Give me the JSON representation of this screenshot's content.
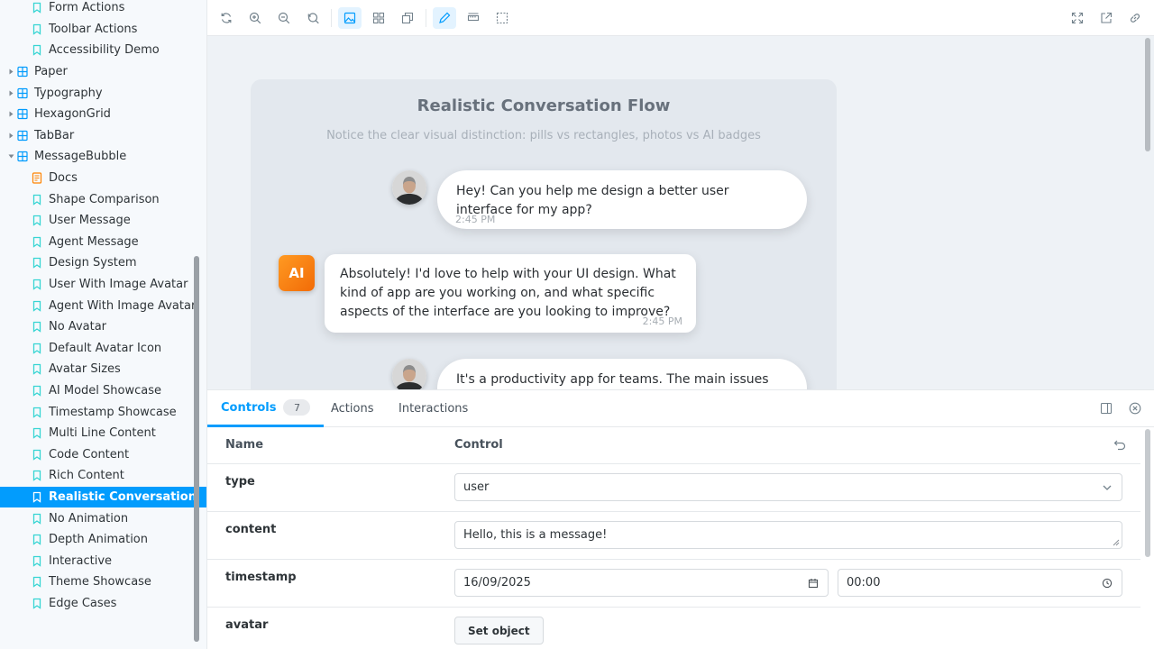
{
  "sidebar": {
    "items": [
      {
        "label": "Form Actions",
        "kind": "story"
      },
      {
        "label": "Toolbar Actions",
        "kind": "story"
      },
      {
        "label": "Accessibility Demo",
        "kind": "story"
      },
      {
        "label": "Paper",
        "kind": "component"
      },
      {
        "label": "Typography",
        "kind": "component"
      },
      {
        "label": "HexagonGrid",
        "kind": "component"
      },
      {
        "label": "TabBar",
        "kind": "component"
      },
      {
        "label": "MessageBubble",
        "kind": "component-open"
      },
      {
        "label": "Docs",
        "kind": "docs"
      },
      {
        "label": "Shape Comparison",
        "kind": "story"
      },
      {
        "label": "User Message",
        "kind": "story"
      },
      {
        "label": "Agent Message",
        "kind": "story"
      },
      {
        "label": "Design System",
        "kind": "story"
      },
      {
        "label": "User With Image Avatar",
        "kind": "story"
      },
      {
        "label": "Agent With Image Avatar",
        "kind": "story"
      },
      {
        "label": "No Avatar",
        "kind": "story"
      },
      {
        "label": "Default Avatar Icon",
        "kind": "story"
      },
      {
        "label": "Avatar Sizes",
        "kind": "story"
      },
      {
        "label": "AI Model Showcase",
        "kind": "story"
      },
      {
        "label": "Timestamp Showcase",
        "kind": "story"
      },
      {
        "label": "Multi Line Content",
        "kind": "story"
      },
      {
        "label": "Code Content",
        "kind": "story"
      },
      {
        "label": "Rich Content",
        "kind": "story"
      },
      {
        "label": "Realistic Conversation",
        "kind": "story",
        "active": true
      },
      {
        "label": "No Animation",
        "kind": "story"
      },
      {
        "label": "Depth Animation",
        "kind": "story"
      },
      {
        "label": "Interactive",
        "kind": "story"
      },
      {
        "label": "Theme Showcase",
        "kind": "story"
      },
      {
        "label": "Edge Cases",
        "kind": "story"
      }
    ]
  },
  "colors": {
    "accent": "#029cfd",
    "story_icon": "#37d5d3",
    "component_icon": "#029cfd",
    "docs_icon": "#ff8300"
  },
  "preview": {
    "title": "Realistic Conversation Flow",
    "subtitle": "Notice the clear visual distinction: pills vs rectangles, photos vs AI badges",
    "messages": [
      {
        "type": "user",
        "text": "Hey! Can you help me design a better user interface for my app?",
        "timestamp": "2:45 PM"
      },
      {
        "type": "agent",
        "badge": "AI",
        "text": "Absolutely! I'd love to help with your UI design. What kind of app are you working on, and what specific aspects of the interface are you looking to improve?",
        "timestamp": "2:45 PM"
      },
      {
        "type": "user",
        "text": "It's a productivity app for teams. The main issues"
      }
    ]
  },
  "panel": {
    "tabs": [
      {
        "label": "Controls",
        "count": "7"
      },
      {
        "label": "Actions"
      },
      {
        "label": "Interactions"
      }
    ],
    "header": {
      "name": "Name",
      "control": "Control"
    },
    "rows": {
      "type": {
        "name": "type",
        "value": "user"
      },
      "content": {
        "name": "content",
        "value": "Hello, this is a message!"
      },
      "timestamp": {
        "name": "timestamp",
        "date": "16/09/2025",
        "time": "00:00"
      },
      "avatar": {
        "name": "avatar",
        "button": "Set object"
      }
    }
  }
}
